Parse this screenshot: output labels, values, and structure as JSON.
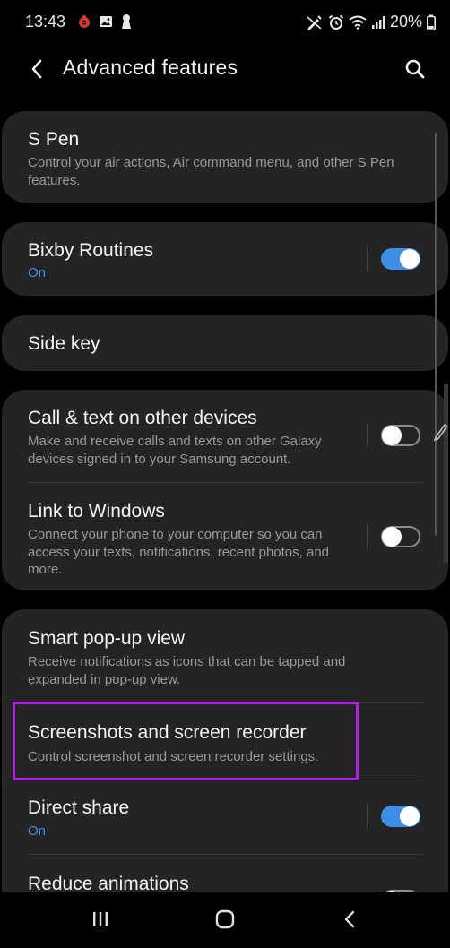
{
  "status_bar": {
    "time": "13:43",
    "battery": "20%"
  },
  "app_bar": {
    "title": "Advanced features"
  },
  "items": {
    "s_pen": {
      "title": "S Pen",
      "subtitle": "Control your air actions, Air command menu, and other S Pen features."
    },
    "bixby": {
      "title": "Bixby Routines",
      "subtitle": "On",
      "toggle": "on"
    },
    "side_key": {
      "title": "Side key"
    },
    "call_text": {
      "title": "Call & text on other devices",
      "subtitle": "Make and receive calls and texts on other Galaxy devices signed in to your Samsung account.",
      "toggle": "off"
    },
    "link_windows": {
      "title": "Link to Windows",
      "subtitle": "Connect your phone to your computer so you can access your texts, notifications, recent photos, and more.",
      "toggle": "off"
    },
    "smart_popup": {
      "title": "Smart pop-up view",
      "subtitle": "Receive notifications as icons that can be tapped and expanded in pop-up view."
    },
    "screenshots": {
      "title": "Screenshots and screen recorder",
      "subtitle": "Control screenshot and screen recorder settings."
    },
    "direct_share": {
      "title": "Direct share",
      "subtitle": "On",
      "toggle": "on"
    },
    "reduce_animations": {
      "title": "Reduce animations",
      "toggle": "off"
    }
  },
  "colors": {
    "accent": "#3e8ee6",
    "card": "#242424",
    "highlight": "#b020e0"
  }
}
